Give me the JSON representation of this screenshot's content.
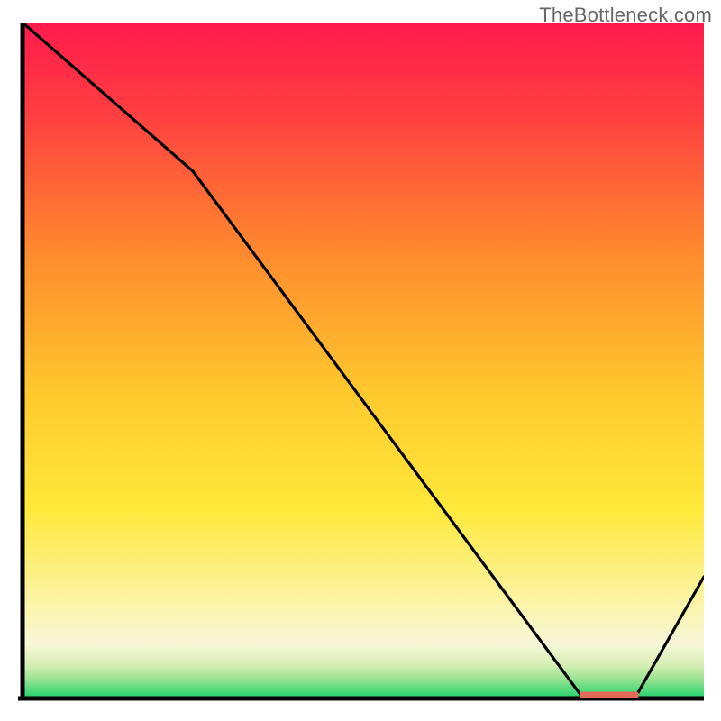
{
  "watermark": "TheBottleneck.com",
  "marker_label": "",
  "colors": {
    "gradient_top": "#ff1a4d",
    "gradient_mid1": "#ff7a2e",
    "gradient_mid2": "#ffe23a",
    "gradient_bottom_pale": "#fdf7cc",
    "gradient_green": "#1fd26a",
    "axis": "#000000",
    "curve": "#000000",
    "marker": "#e26a56"
  },
  "chart_data": {
    "type": "line",
    "title": "",
    "xlabel": "",
    "ylabel": "",
    "xlim": [
      0,
      100
    ],
    "ylim": [
      0,
      100
    ],
    "x": [
      0,
      25,
      82,
      90,
      100
    ],
    "y": [
      100,
      78,
      0,
      0,
      18
    ],
    "marker_x_range": [
      82,
      90
    ],
    "marker_y": 0,
    "notes": "V-shaped bottleneck curve over vertical heat gradient from red (top) to green (bottom). Short flat minimum segment near x≈82–90 marked with a small horizontal red bar."
  }
}
